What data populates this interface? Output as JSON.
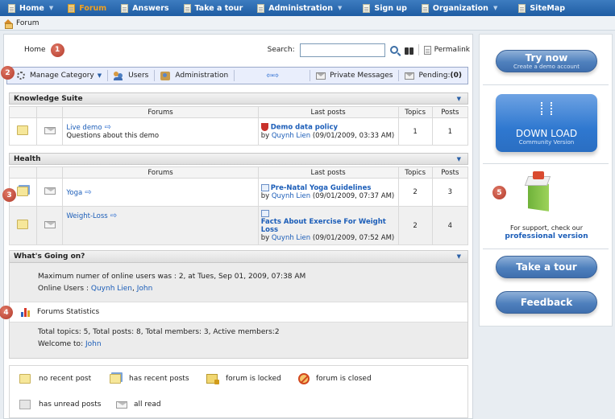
{
  "nav": {
    "items": [
      {
        "label": "Home",
        "caret": true
      },
      {
        "label": "Forum",
        "caret": false,
        "active": true
      },
      {
        "label": "Answers",
        "caret": false
      },
      {
        "label": "Take a tour",
        "caret": false
      },
      {
        "label": "Administration",
        "caret": true
      },
      {
        "label": "Sign up",
        "caret": false
      },
      {
        "label": "Organization",
        "caret": true
      },
      {
        "label": "SiteMap",
        "caret": false
      }
    ]
  },
  "breadcrumb": {
    "label": "Forum"
  },
  "topbar": {
    "home": "Home",
    "search_label": "Search:",
    "search_value": "",
    "permalink": "Permalink"
  },
  "badges": [
    "1",
    "2",
    "3",
    "4",
    "5"
  ],
  "toolbar": {
    "manage_category": "Manage Category",
    "users": "Users",
    "administration": "Administration",
    "private_messages": "Private Messages",
    "pending_label": "Pending:",
    "pending_count": "(0)"
  },
  "table_headers": {
    "forums": "Forums",
    "last_posts": "Last posts",
    "topics": "Topics",
    "posts": "Posts"
  },
  "categories": [
    {
      "title": "Knowledge Suite",
      "forums": [
        {
          "name": "Live demo",
          "description": "Questions about this demo",
          "last_post_title": "Demo data policy",
          "by": "by",
          "author": "Quynh Lien",
          "date": "(09/01/2009, 03:33 AM)",
          "topics": "1",
          "posts": "1"
        }
      ]
    },
    {
      "title": "Health",
      "forums": [
        {
          "name": "Yoga",
          "description": "",
          "last_post_title": "Pre-Natal Yoga Guidelines",
          "by": "by",
          "author": "Quynh Lien",
          "date": "(09/01/2009, 07:37 AM)",
          "topics": "2",
          "posts": "3"
        },
        {
          "name": "Weight-Loss",
          "description": "",
          "last_post_title": "Facts About Exercise For Weight Loss",
          "by": "by",
          "author": "Quynh Lien",
          "date": "(09/01/2009, 07:52 AM)",
          "topics": "2",
          "posts": "4"
        }
      ]
    }
  ],
  "whats_going_on": {
    "title": "What's Going on?",
    "max_online": "Maximum numer of online users was : 2, at Tues, Sep 01, 2009, 07:38 AM",
    "online_users_label": "Online Users :",
    "online_user_1": "Quynh Lien",
    "online_sep": ",",
    "online_user_2": "John",
    "stats_title": "Forums Statistics",
    "totals": "Total topics: 5, Total posts: 8, Total members: 3, Active members:2",
    "welcome_label": "Welcome to:",
    "welcome_user": "John"
  },
  "legend": {
    "no_recent": "no recent post",
    "has_recent": "has recent posts",
    "locked": "forum is locked",
    "closed": "forum is closed",
    "unread": "has unread posts",
    "all_read": "all read"
  },
  "sidebar": {
    "try_now": "Try now",
    "try_now_sub": "Create a demo account",
    "download": "DOWN LOAD",
    "download_sub": "Community Version",
    "support_text": "For support, check our",
    "professional": "professional version",
    "take_tour": "Take a tour",
    "feedback": "Feedback"
  },
  "colors": {
    "accent": "#1b5db8",
    "nav_bg": "#2a69b0",
    "badge": "#b23a2b"
  }
}
